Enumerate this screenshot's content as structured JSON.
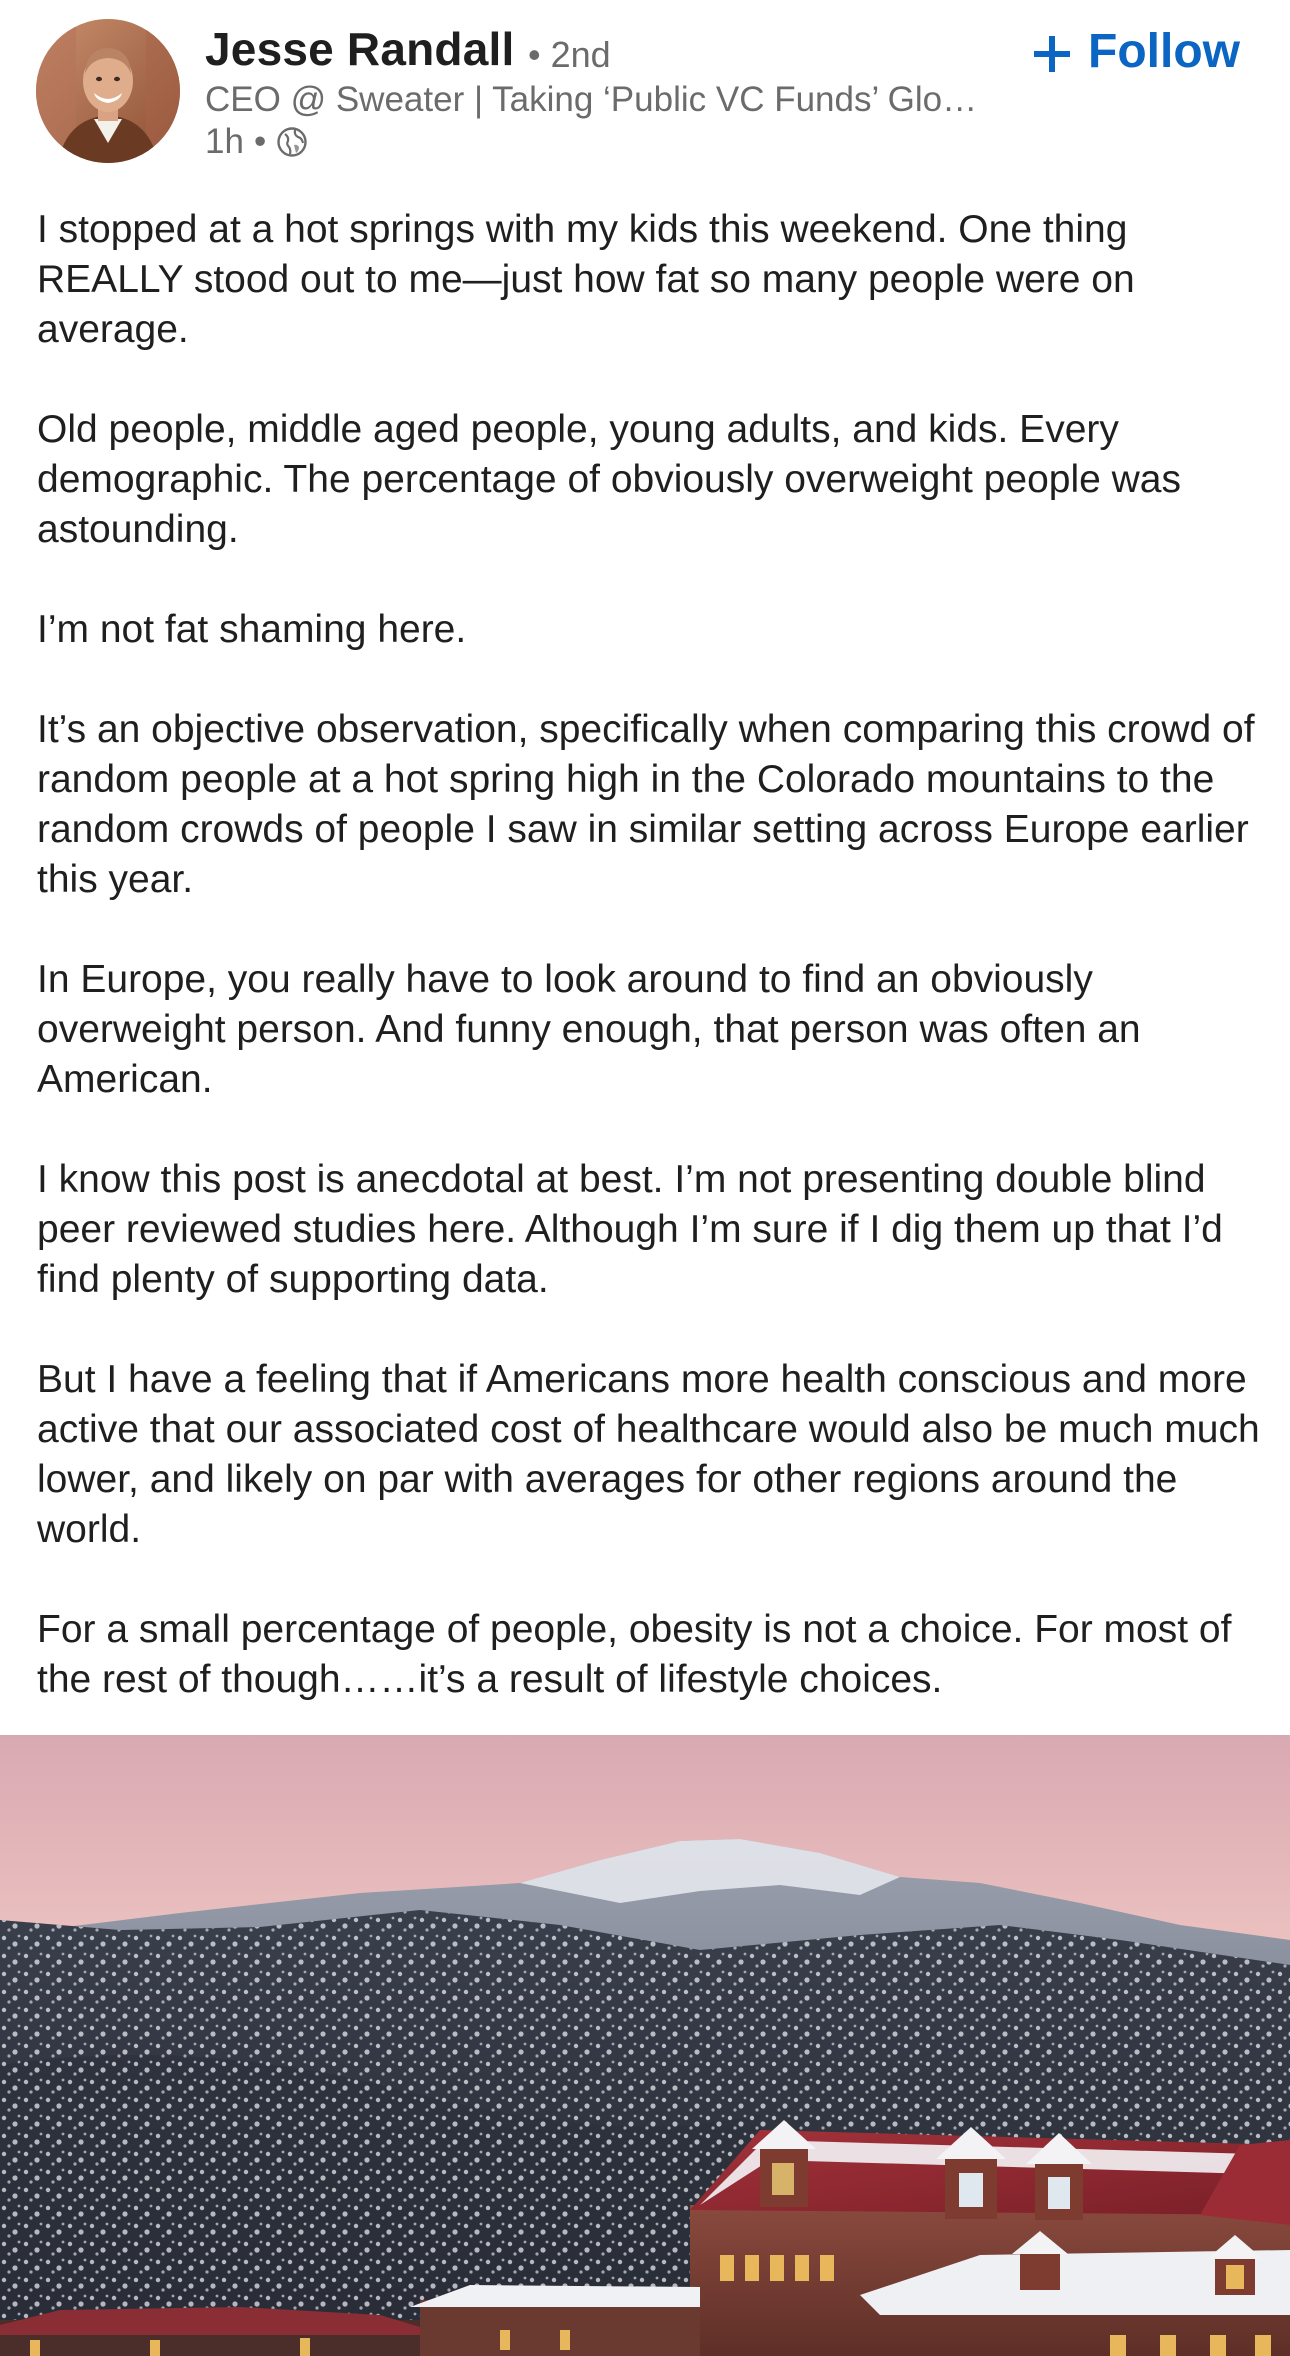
{
  "post": {
    "author": {
      "name": "Jesse Randall",
      "degree": "• 2nd",
      "headline": "CEO @ Sweater | Taking ‘Public VC Funds’ Glo…",
      "time": "1h",
      "visibility_icon": "globe-icon"
    },
    "follow_label": "Follow",
    "follow_icon": "plus-icon",
    "accent_color": "#0a66c2",
    "paragraphs": [
      "I stopped at a hot springs with my kids this weekend. One thing REALLY stood out to me—just how fat so many people were on average.",
      "Old people, middle aged people, young adults, and kids. Every demographic. The percentage of obviously overweight people was astounding.",
      "I’m not fat shaming here.",
      "It’s an objective observation, specifically when comparing this crowd of random people at a hot spring high in the Colorado mountains to the random crowds of people I saw in similar setting across Europe earlier this year.",
      "In Europe, you really have to look around to find an obviously overweight person. And funny enough, that person was often an American.",
      "I know this post is anecdotal at best. I’m not presenting double blind peer reviewed studies here. Although I’m sure if I dig them up that I’d find plenty of supporting data.",
      "But I have a feeling that if Americans more health conscious and more active that our associated cost of healthcare would also be much much lower, and likely on par with averages for other regions around the world.",
      "For a small percentage of people, obesity is not a choice. For most of the rest of though……it’s a result of lifestyle choices."
    ]
  }
}
